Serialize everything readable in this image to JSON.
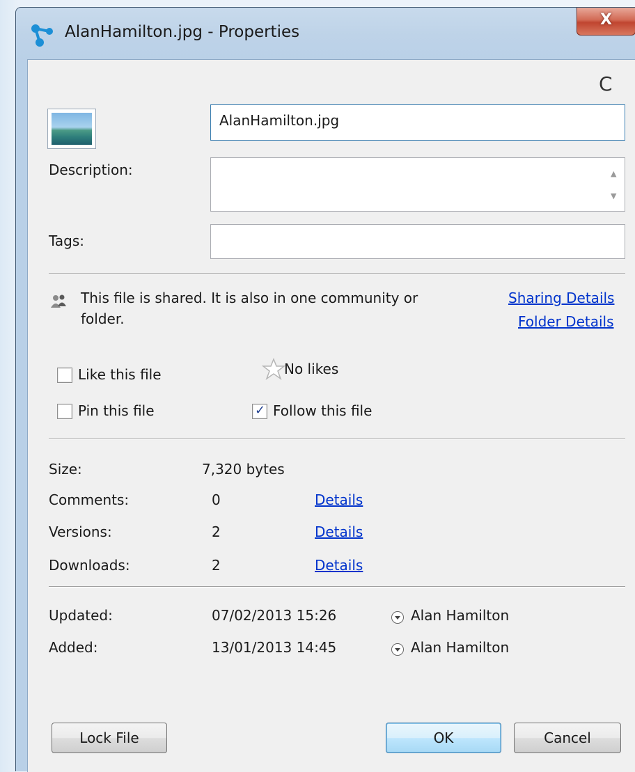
{
  "window": {
    "title": "AlanHamilton.jpg - Properties",
    "close_label": "X",
    "refresh_glyph": "C"
  },
  "file": {
    "name_value": "AlanHamilton.jpg",
    "description_label": "Description:",
    "description_value": "",
    "tags_label": "Tags:",
    "tags_value": ""
  },
  "sharing": {
    "message": "This file is shared. It is also in one community or",
    "message_cont": "folder.",
    "sharing_details_link": "Sharing Details",
    "folder_details_link": "Folder Details"
  },
  "actions": {
    "like_label": "Like this file",
    "like_checked": false,
    "likes_text": "No likes",
    "pin_label": "Pin this file",
    "pin_checked": false,
    "follow_label": "Follow this file",
    "follow_checked": true
  },
  "stats": [
    {
      "label": "Size:",
      "value": "7,320 bytes",
      "link": ""
    },
    {
      "label": "Comments:",
      "value": "0",
      "link": "Details"
    },
    {
      "label": "Versions:",
      "value": "2",
      "link": "Details"
    },
    {
      "label": "Downloads:",
      "value": "2",
      "link": "Details"
    }
  ],
  "history": [
    {
      "label": "Updated:",
      "date": "07/02/2013 15:26",
      "user": "Alan Hamilton"
    },
    {
      "label": "Added:",
      "date": "13/01/2013 14:45",
      "user": "Alan Hamilton"
    }
  ],
  "buttons": {
    "lock": "Lock File",
    "ok": "OK",
    "cancel": "Cancel"
  },
  "colors": {
    "link": "#0033cc",
    "titlebar": "#bed3e8",
    "close": "#c04530"
  },
  "icons": {
    "app": "connections-icon",
    "refresh": "refresh-icon",
    "thumbnail": "image-thumbnail-icon",
    "shared": "shared-users-icon",
    "likes": "star-icon",
    "user_menu": "user-dropdown-icon"
  }
}
